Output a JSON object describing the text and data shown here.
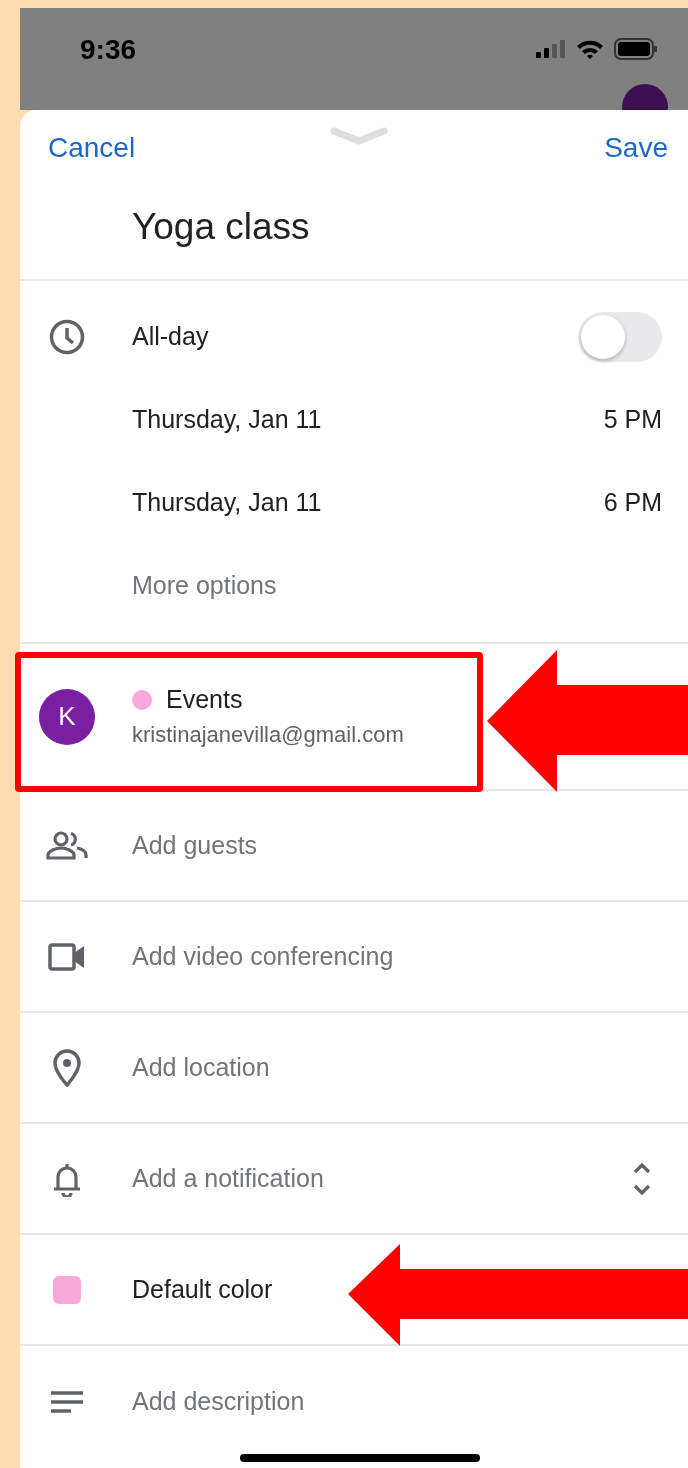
{
  "status_bar": {
    "time": "9:36"
  },
  "header": {
    "cancel": "Cancel",
    "save": "Save"
  },
  "title": "Yoga class",
  "all_day": {
    "label": "All-day",
    "on": false
  },
  "dates": [
    {
      "date": "Thursday, Jan 11",
      "time": "5 PM"
    },
    {
      "date": "Thursday, Jan 11",
      "time": "6 PM"
    }
  ],
  "more_options": "More options",
  "calendar": {
    "initial": "K",
    "name": "Events",
    "color": "#f9a8dc",
    "account": "kristinajanevilla@gmail.com"
  },
  "rows": [
    {
      "kind": "guests",
      "label": "Add guests"
    },
    {
      "kind": "video",
      "label": "Add video conferencing"
    },
    {
      "kind": "location",
      "label": "Add location"
    },
    {
      "kind": "notification",
      "label": "Add a notification"
    },
    {
      "kind": "color",
      "label": "Default color",
      "color": "#f9a8dc"
    },
    {
      "kind": "description",
      "label": "Add description"
    }
  ]
}
